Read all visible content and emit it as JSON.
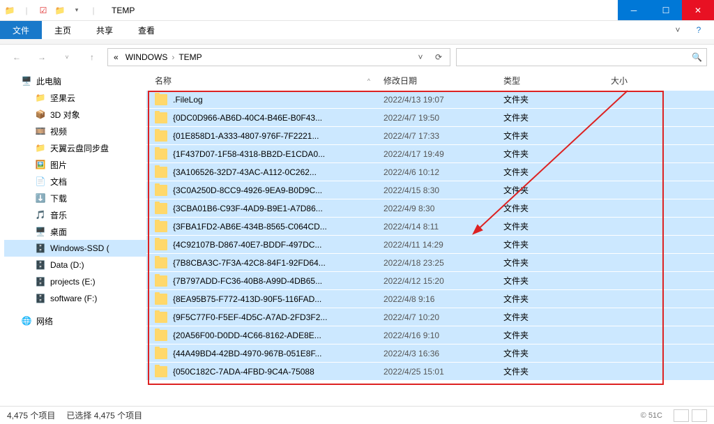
{
  "titlebar": {
    "title": "TEMP"
  },
  "ribbon": {
    "file": "文件",
    "home": "主页",
    "share": "共享",
    "view": "查看"
  },
  "breadcrumb": {
    "p1": "WINDOWS",
    "p2": "TEMP"
  },
  "nav": {
    "thispc": "此电脑",
    "jianguo": "坚果云",
    "objects3d": "3D 对象",
    "video": "视频",
    "tianyi": "天翼云盘同步盘",
    "pictures": "图片",
    "documents": "文档",
    "downloads": "下载",
    "music": "音乐",
    "desktop": "桌面",
    "winssd": "Windows-SSD (",
    "datad": "Data (D:)",
    "projects": "projects (E:)",
    "software": "software (F:)",
    "network": "网络"
  },
  "columns": {
    "name": "名称",
    "date": "修改日期",
    "type": "类型",
    "size": "大小"
  },
  "type_folder": "文件夹",
  "files": [
    {
      "name": ".FileLog",
      "date": "2022/4/13 19:07"
    },
    {
      "name": "{0DC0D966-AB6D-40C4-B46E-B0F43...",
      "date": "2022/4/7 19:50"
    },
    {
      "name": "{01E858D1-A333-4807-976F-7F2221...",
      "date": "2022/4/7 17:33"
    },
    {
      "name": "{1F437D07-1F58-4318-BB2D-E1CDA0...",
      "date": "2022/4/17 19:49"
    },
    {
      "name": "{3A106526-32D7-43AC-A112-0C262...",
      "date": "2022/4/6 10:12"
    },
    {
      "name": "{3C0A250D-8CC9-4926-9EA9-B0D9C...",
      "date": "2022/4/15 8:30"
    },
    {
      "name": "{3CBA01B6-C93F-4AD9-B9E1-A7D86...",
      "date": "2022/4/9 8:30"
    },
    {
      "name": "{3FBA1FD2-AB6E-434B-8565-C064CD...",
      "date": "2022/4/14 8:11"
    },
    {
      "name": "{4C92107B-D867-40E7-BDDF-497DC...",
      "date": "2022/4/11 14:29"
    },
    {
      "name": "{7B8CBA3C-7F3A-42C8-84F1-92FD64...",
      "date": "2022/4/18 23:25"
    },
    {
      "name": "{7B797ADD-FC36-40B8-A99D-4DB65...",
      "date": "2022/4/12 15:20"
    },
    {
      "name": "{8EA95B75-F772-413D-90F5-116FAD...",
      "date": "2022/4/8 9:16"
    },
    {
      "name": "{9F5C77F0-F5EF-4D5C-A7AD-2FD3F2...",
      "date": "2022/4/7 10:20"
    },
    {
      "name": "{20A56F00-D0DD-4C66-8162-ADE8E...",
      "date": "2022/4/16 9:10"
    },
    {
      "name": "{44A49BD4-42BD-4970-967B-051E8F...",
      "date": "2022/4/3 16:36"
    },
    {
      "name": "{050C182C-7ADA-4FBD-9C4A-75088",
      "date": "2022/4/25 15:01"
    }
  ],
  "status": {
    "count": "4,475 个项目",
    "selection": "已选择 4,475 个项目",
    "watermark": "© 51C"
  }
}
